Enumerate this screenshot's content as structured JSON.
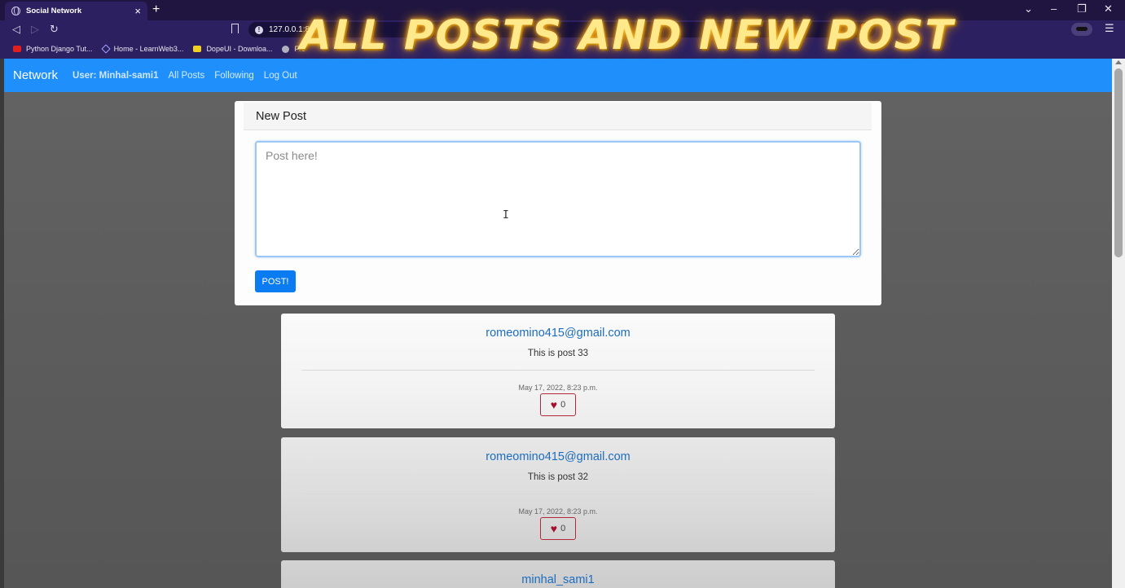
{
  "browser": {
    "tab_title": "Social Network",
    "url": "127.0.0.1:8",
    "bookmarks": [
      "Python Django Tut...",
      "Home - LearnWeb3...",
      "DopeUI - Downloa...",
      "Fro"
    ]
  },
  "video_overlay_title": "ALL POSTS AND NEW POST",
  "navbar": {
    "brand": "Network",
    "user_label": "User: Minhal-sami1",
    "links": [
      "All Posts",
      "Following",
      "Log Out"
    ]
  },
  "new_post": {
    "header": "New Post",
    "placeholder": "Post here!",
    "button_label": "POST!"
  },
  "posts": [
    {
      "author": "romeomino415@gmail.com",
      "body": "This is post 33",
      "date": "May 17, 2022, 8:23 p.m.",
      "likes": "0"
    },
    {
      "author": "romeomino415@gmail.com",
      "body": "This is post 32",
      "date": "May 17, 2022, 8:23 p.m.",
      "likes": "0"
    },
    {
      "author": "minhal_sami1"
    }
  ],
  "icons": {
    "like": "heart-icon",
    "accent_color": "#1e8ffb",
    "like_color": "#a3112f"
  }
}
